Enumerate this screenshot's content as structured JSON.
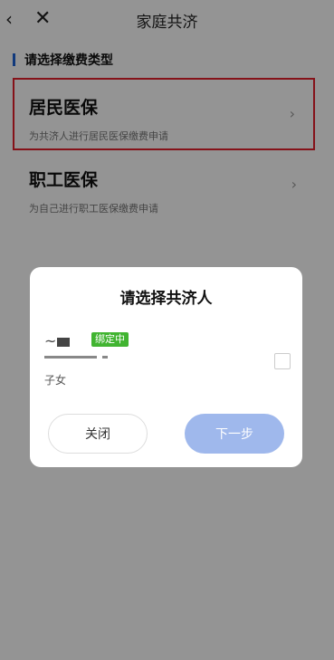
{
  "header": {
    "back_icon": "‹",
    "close_icon": "✕",
    "title": "家庭共济"
  },
  "section": {
    "title": "请选择缴费类型"
  },
  "cards": [
    {
      "title": "居民医保",
      "subtitle": "为共济人进行居民医保缴费申请",
      "selected": true
    },
    {
      "title": "职工医保",
      "subtitle": "为自己进行职工医保缴费申请",
      "selected": false
    }
  ],
  "modal": {
    "title": "请选择共济人",
    "person": {
      "status_badge": "绑定中",
      "relation": "子女",
      "checked": false
    },
    "close_label": "关闭",
    "next_label": "下一步"
  },
  "colors": {
    "accent_blue": "#1e63d6",
    "highlight_red": "#e5202b",
    "badge_green": "#41b431",
    "next_button": "#9fb8ec"
  }
}
